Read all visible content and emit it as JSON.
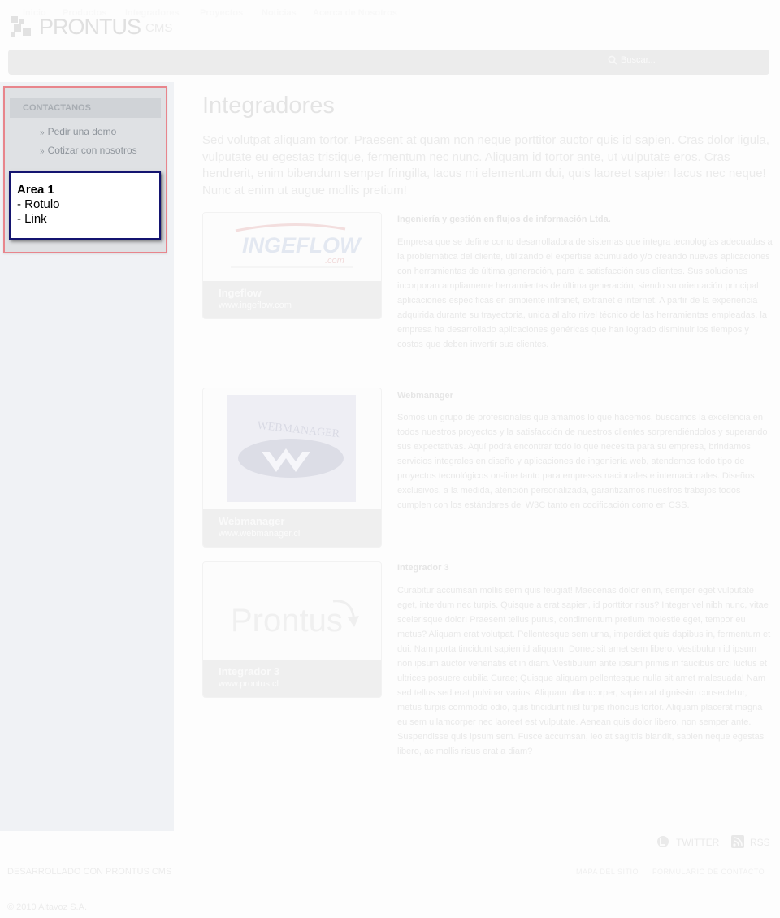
{
  "header": {
    "logo_text": "PRONTUS",
    "logo_suffix": "CMS"
  },
  "nav": {
    "items": [
      "Inicio",
      "Productos",
      "Integradores",
      "Proyectos",
      "Noticias",
      "Acerca de Nosotros"
    ],
    "search_placeholder": "Buscar..."
  },
  "sidebar": {
    "contact_title": "CONTACTANOS",
    "links": [
      "Pedir una demo",
      "Cotizar con nosotros"
    ],
    "area": {
      "title": "Area 1",
      "line1": "- Rotulo",
      "line2": "- Link"
    }
  },
  "main": {
    "title": "Integradores",
    "intro": "Sed volutpat aliquam tortor. Praesent at quam non neque porttitor auctor quis id sapien. Cras dolor ligula, vulputate eu egestas tristique, fermentum nec nunc. Aliquam id tortor ante, ut vulputate eros. Cras hendrerit, enim bibendum semper fringilla, lacus mi elementum dui, quis laoreet sapien lacus nec neque! Nunc at enim ut augue mollis pretium!",
    "integrators": [
      {
        "name": "Ingeflow",
        "url": "www.ingeflow.com",
        "logo_text": "INGEFLOW",
        "logo_sub": ".com",
        "heading": "Ingeniería y gestión en flujos de información Ltda.",
        "description": "Empresa que se define como desarrolladora de sistemas que integra tecnologías adecuadas a la problemática del cliente, utilizando el expertise acumulado y/o creando nuevas aplicaciones con herramientas de última generación, para la satisfacción sus clientes. Sus soluciones incorporan ampliamente herramientas de última generación, siendo su orientación principal aplicaciones específicas en ambiente intranet, extranet e internet. A partir de la experiencia adquirida durante su trayectoria, unida al alto nivel técnico de las herramientas empleadas, la empresa ha desarrollado aplicaciones genéricas que han logrado disminuir los tiempos y costos que deben invertir sus clientes."
      },
      {
        "name": "Webmanager",
        "url": "www.webmanager.cl",
        "logo_text": "WEBMANAGER",
        "heading": "Webmanager",
        "description": "Somos un grupo de profesionales que amamos lo que hacemos, buscamos la excelencia en todos nuestros proyectos y la satisfacción de nuestros clientes sorprendiéndolos y superando sus expectativas. Aquí podrá encontrar todo lo que necesita para su empresa, brindamos servicios integrales en diseño y aplicaciones de ingeniería web, atendemos todo tipo de proyectos tecnológicos on-line tanto para empresas nacionales e internacionales. Diseños exclusivos, a la medida, atención personalizada, garantizamos nuestros trabajos todos cumplen con los estándares del W3C tanto en codificación como en CSS."
      },
      {
        "name": "Integrador 3",
        "url": "www.prontus.cl",
        "logo_text": "Prontus",
        "heading": "Integrador 3",
        "description": "Curabitur accumsan mollis sem quis feugiat! Maecenas dolor enim, semper eget vulputate eget, interdum nec turpis. Quisque a erat sapien, id porttitor risus? Integer vel nibh nunc, vitae scelerisque dolor! Praesent tellus purus, condimentum pretium molestie eget, tempor eu metus? Aliquam erat volutpat. Pellentesque sem urna, imperdiet quis dapibus in, fermentum et dui. Nam porta tincidunt sapien id aliquam. Donec sit amet sem libero. Vestibulum id ipsum non ipsum auctor venenatis et in diam. Vestibulum ante ipsum primis in faucibus orci luctus et ultrices posuere cubilia Curae; Quisque aliquam pellentesque nulla sit amet malesuada! Nam sed tellus sed erat pulvinar varius. Aliquam ullamcorper, sapien at dignissim consectetur, metus turpis commodo odio, quis tincidunt nisl turpis rhoncus tortor. Aliquam placerat magna eu sem ullamcorper nec laoreet est vulputate. Aenean quis dolor libero, non semper ante. Suspendisse quis ipsum sem. Fusce accumsan, leo at sagittis blandit, sapien neque egestas libero, ac mollis risus erat a diam?"
      }
    ]
  },
  "footer": {
    "twitter": "TWITTER",
    "rss": "RSS",
    "developed_by": "DESARROLLADO CON PRONTUS CMS",
    "sitemap": "MAPA DEL SITIO",
    "contact_form": "FORMULARIO DE CONTACTO",
    "copyright": "© 2010 Altavoz S.A."
  }
}
